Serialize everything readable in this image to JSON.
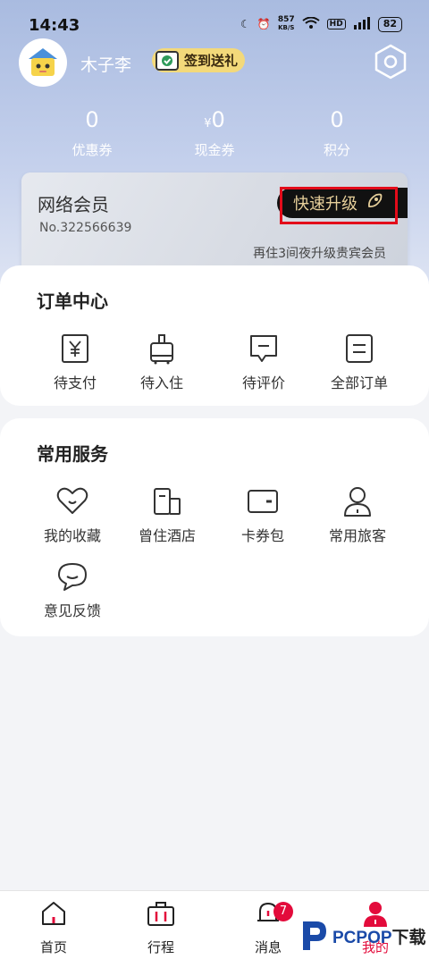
{
  "status_bar": {
    "time": "14:43",
    "net_speed": "857",
    "net_unit": "KB/S",
    "hd": "HD",
    "battery": "82"
  },
  "profile": {
    "username": "木子李",
    "checkin_label": "签到送礼"
  },
  "stats": [
    {
      "value": "0",
      "prefix": "",
      "label": "优惠券"
    },
    {
      "value": "0",
      "prefix": "¥",
      "label": "现金券"
    },
    {
      "value": "0",
      "prefix": "",
      "label": "积分"
    }
  ],
  "member_card": {
    "title": "网络会员",
    "number": "No.322566639",
    "upgrade_label": "快速升级",
    "hint": "再住3间夜升级贵宾会员"
  },
  "order_center": {
    "title": "订单中心",
    "items": [
      {
        "label": "待支付",
        "icon": "yuan-receipt-icon"
      },
      {
        "label": "待入住",
        "icon": "luggage-icon"
      },
      {
        "label": "待评价",
        "icon": "comment-icon"
      },
      {
        "label": "全部订单",
        "icon": "document-icon"
      }
    ]
  },
  "services": {
    "title": "常用服务",
    "items": [
      {
        "label": "我的收藏",
        "icon": "heart-icon"
      },
      {
        "label": "曾住酒店",
        "icon": "building-icon"
      },
      {
        "label": "卡券包",
        "icon": "wallet-icon"
      },
      {
        "label": "常用旅客",
        "icon": "person-icon"
      },
      {
        "label": "意见反馈",
        "icon": "feedback-icon"
      }
    ]
  },
  "tabbar": {
    "tabs": [
      {
        "label": "首页",
        "icon": "home-icon"
      },
      {
        "label": "行程",
        "icon": "suitcase-icon"
      },
      {
        "label": "消息",
        "icon": "bell-icon",
        "badge": "7"
      },
      {
        "label": "我的",
        "icon": "user-icon",
        "active": true
      }
    ]
  },
  "watermark": {
    "brand": "PCPOP",
    "suffix": "下载"
  },
  "colors": {
    "accent": "#e30b3b",
    "hero": "#b3c3e6",
    "gold": "#e6cf9a"
  }
}
